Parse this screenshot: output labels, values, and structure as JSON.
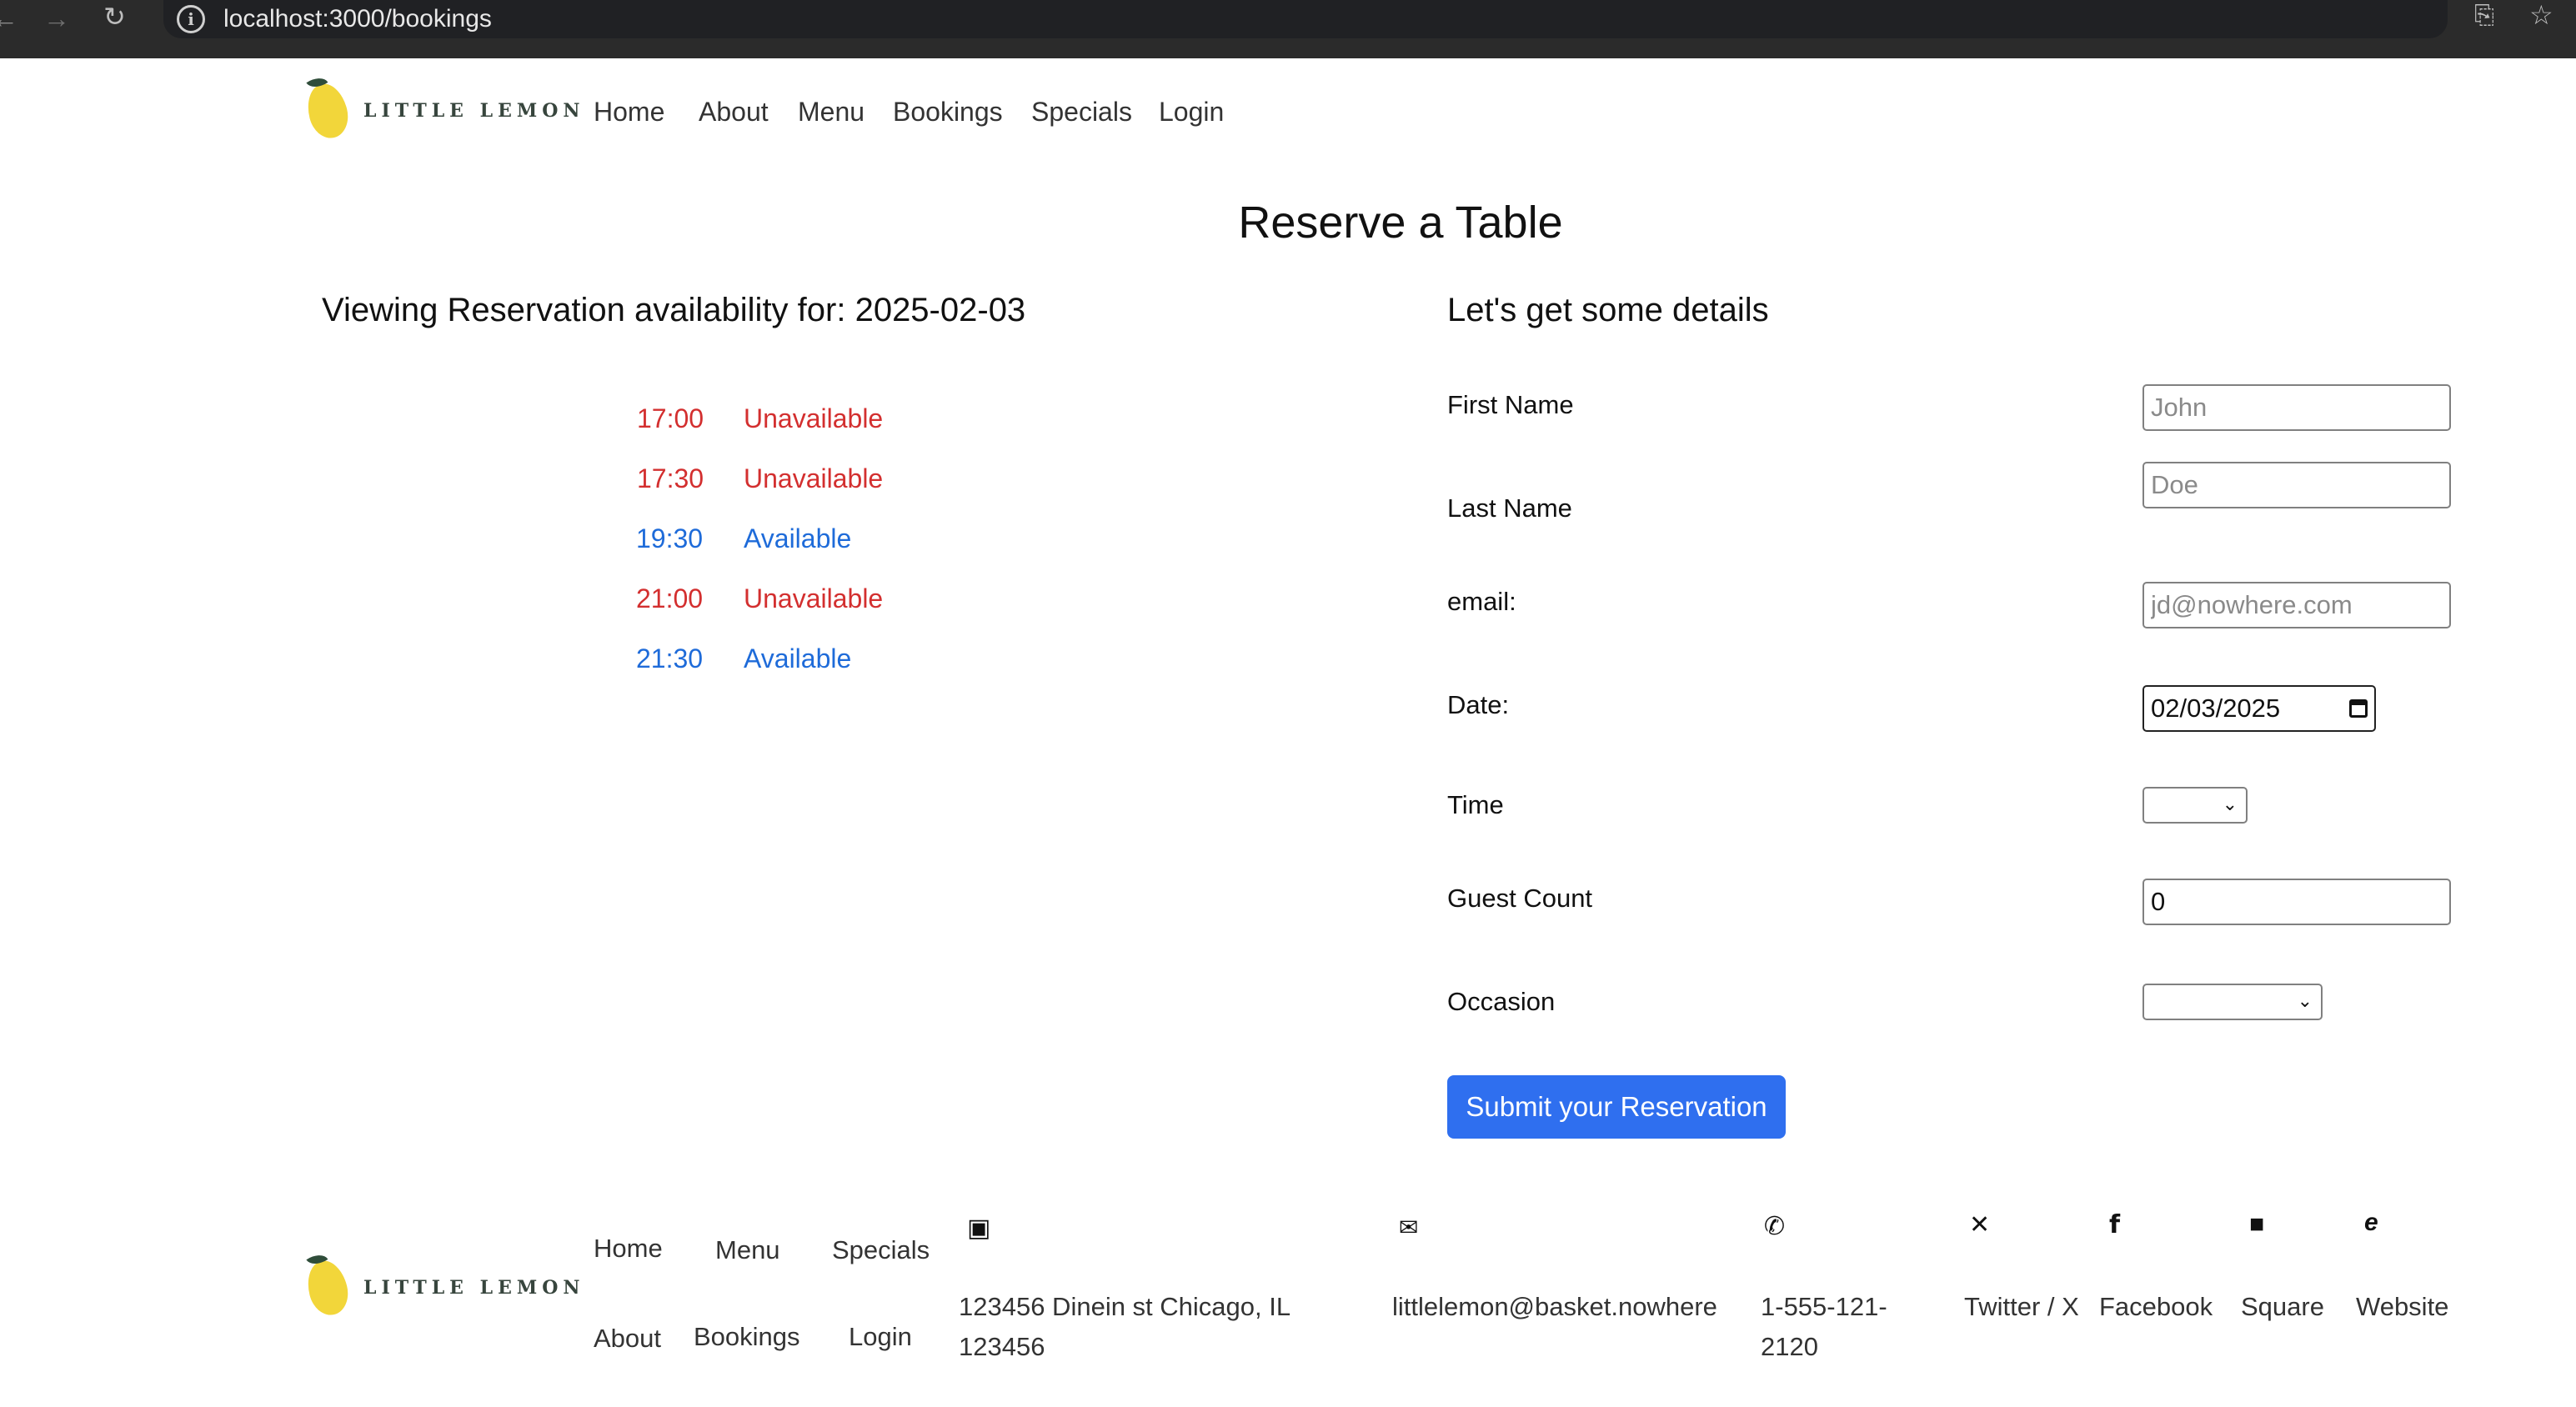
{
  "browser": {
    "url": "localhost:3000/bookings",
    "icons": [
      "back-arrow-icon",
      "forward-arrow-icon",
      "reload-icon",
      "site-info-icon",
      "install-app-icon",
      "bookmark-star-icon"
    ]
  },
  "header": {
    "logo_text": "LITTLE LEMON",
    "nav": [
      "Home",
      "About",
      "Menu",
      "Bookings",
      "Specials",
      "Login"
    ]
  },
  "main": {
    "title": "Reserve a Table",
    "availability": {
      "heading": "Viewing Reservation availability for: 2025-02-03",
      "slots": [
        {
          "time": "17:00",
          "status": "Unavailable"
        },
        {
          "time": "17:30",
          "status": "Unavailable"
        },
        {
          "time": "19:30",
          "status": "Available"
        },
        {
          "time": "21:00",
          "status": "Unavailable"
        },
        {
          "time": "21:30",
          "status": "Available"
        }
      ]
    },
    "form": {
      "heading": "Let's get some details",
      "first_name": {
        "label": "First Name",
        "placeholder": "John",
        "value": ""
      },
      "last_name": {
        "label": "Last Name",
        "placeholder": "Doe",
        "value": ""
      },
      "email": {
        "label": "email:",
        "placeholder": "jd@nowhere.com",
        "value": ""
      },
      "date": {
        "label": "Date:",
        "value": "02/03/2025"
      },
      "time": {
        "label": "Time",
        "value": ""
      },
      "guests": {
        "label": "Guest Count",
        "value": "0"
      },
      "occasion": {
        "label": "Occasion",
        "value": ""
      },
      "submit_label": "Submit your Reservation"
    }
  },
  "footer": {
    "logo_text": "LITTLE LEMON",
    "nav": [
      "Home",
      "Menu",
      "Specials",
      "About",
      "Bookings",
      "Login"
    ],
    "address": {
      "icon": "address-book-icon",
      "text": "123456 Dinein st Chicago, IL 123456"
    },
    "email": {
      "icon": "envelope-icon",
      "text": "littlelemon@basket.nowhere"
    },
    "phone": {
      "icon": "phone-icon",
      "text": "1-555-121-2120"
    },
    "socials": [
      {
        "icon": "x-twitter-icon",
        "label": "Twitter / X"
      },
      {
        "icon": "facebook-icon",
        "label": "Facebook"
      },
      {
        "icon": "square-icon",
        "label": "Square"
      },
      {
        "icon": "website-icon",
        "label": "Website"
      }
    ]
  },
  "colors": {
    "unavailable": "#d32f2f",
    "available": "#1e6bd9",
    "button": "#2f6fef",
    "lemon": "#f2d63a"
  }
}
